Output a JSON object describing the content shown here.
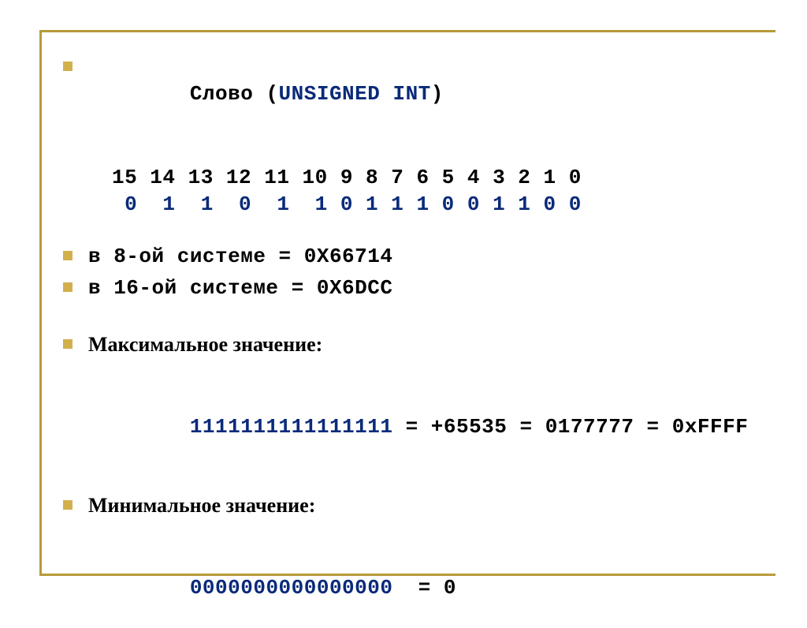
{
  "items": {
    "heading_word": "Слово (",
    "heading_type": "UNSIGNED INT",
    "heading_close": ")",
    "bit_indices": "15 14 13 12 11 10 9 8 7 6 5 4 3 2 1 0",
    "bit_values": " 0  1  1  0  1  1 0 1 1 1 0 0 1 1 0 0",
    "octal_line": "в 8-ой системе = 0X66714",
    "hex_line": "в 16-ой системе = 0X6DCC",
    "max_label": "Максимальное значение:",
    "max_bits": "1111111111111111",
    "max_rest": " = +65535 = 0177777 = 0xFFFF",
    "min_label": "Минимальное значение:",
    "min_bits": "0000000000000000",
    "min_rest": "  = 0"
  }
}
